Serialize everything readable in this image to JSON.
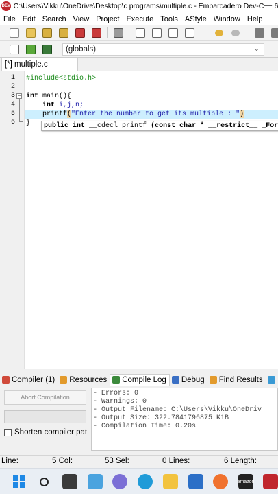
{
  "window": {
    "title": "C:\\Users\\Vikku\\OneDrive\\Desktop\\c programs\\multiple.c - Embarcadero Dev-C++ 6.3",
    "app_icon_text": "DEV"
  },
  "menu": [
    "File",
    "Edit",
    "Search",
    "View",
    "Project",
    "Execute",
    "Tools",
    "AStyle",
    "Window",
    "Help"
  ],
  "toolbar": {
    "scope_select_value": "(globals)"
  },
  "editor": {
    "tab_label": "[*] multiple.c",
    "line_numbers": [
      "1",
      "2",
      "3",
      "4",
      "5",
      "6"
    ],
    "lines": {
      "l1_directive": "#include<stdio.h>",
      "l3_kw": "int",
      "l3_rest": " main(){",
      "l4_kw": "int",
      "l4_rest": " i,j,n;",
      "l5_fn": "printf",
      "l5_open": "(",
      "l5_str": "\"Enter the number to get its multiple : \"",
      "l5_close": ")",
      "l6": "}"
    },
    "tooltip": {
      "kw1": "public",
      "kw2": "int",
      "middle": " __cdecl printf ",
      "args": "(const char * __restrict__ _For"
    }
  },
  "bottom_tabs": [
    {
      "label": "Compiler (1)",
      "icon": "compiler-icon",
      "color": "#d04a3a"
    },
    {
      "label": "Resources",
      "icon": "resources-icon",
      "color": "#e29a2c"
    },
    {
      "label": "Compile Log",
      "icon": "compile-log-icon",
      "color": "#3c8a3c"
    },
    {
      "label": "Debug",
      "icon": "debug-icon",
      "color": "#3a6fc4"
    },
    {
      "label": "Find Results",
      "icon": "find-results-icon",
      "color": "#e29a2c"
    }
  ],
  "compile_panel": {
    "abort_label": "Abort Compilation",
    "shorten_label": "Shorten compiler pat",
    "log": [
      "- Errors: 0",
      "- Warnings: 0",
      "- Output Filename: C:\\Users\\Vikku\\OneDriv",
      "- Output Size: 322.7841796875 KiB",
      "- Compilation Time: 0.20s"
    ]
  },
  "status": {
    "line": "Line:",
    "col": "5 Col:",
    "sel": "53 Sel:",
    "lines": "0 Lines:",
    "length": "6 Length:"
  },
  "taskbar": [
    "windows-start-icon",
    "search-icon",
    "file-explorer-icon",
    "snap-layout-icon",
    "teams-chat-icon",
    "edge-icon",
    "folder-icon",
    "mail-icon",
    "firefox-icon",
    "amazon-icon",
    "calendar-icon"
  ]
}
